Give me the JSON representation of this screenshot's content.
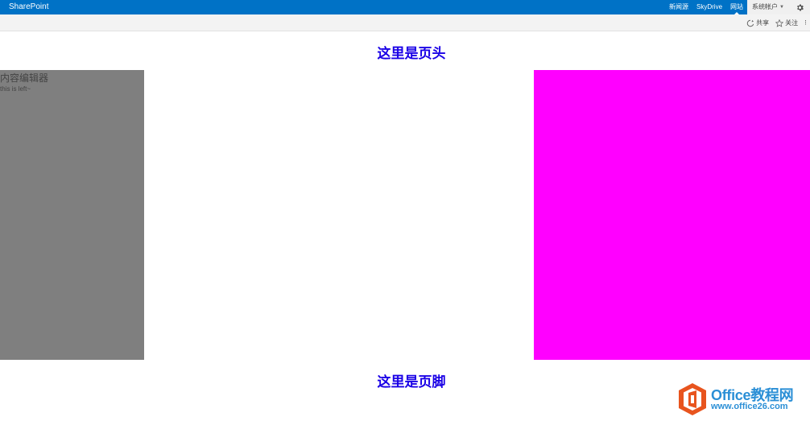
{
  "suitebar": {
    "brand": "SharePoint",
    "links": [
      "新闻源",
      "SkyDrive",
      "网站"
    ],
    "active_link": "网站",
    "user": "系统帐户",
    "settings_icon": "gear-icon",
    "color": "#0072c6"
  },
  "ribbon": {
    "share_label": "共享",
    "follow_label": "关注",
    "focus_icon": "focus-on-content-icon"
  },
  "page": {
    "header": "这里是页头",
    "footer": "这里是页脚",
    "heading_color": "#1a00e6"
  },
  "left_webpart": {
    "title": "内容编辑器",
    "body": "this is left~",
    "background": "#7f7f7f"
  },
  "right_column": {
    "background": "#ff00ff"
  },
  "watermark": {
    "line1": "Office教程网",
    "line2": "www.office26.com",
    "logo_color": "#e8541e"
  }
}
